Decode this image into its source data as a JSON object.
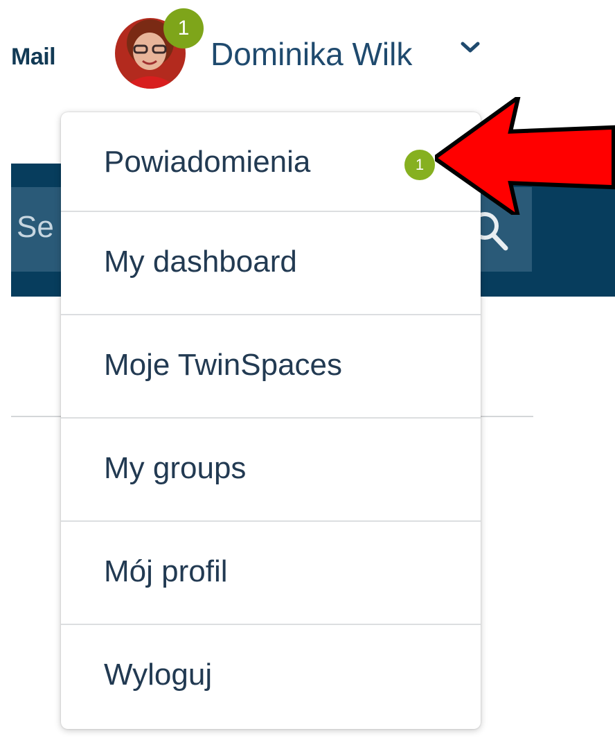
{
  "header": {
    "mail_label": "Mail",
    "user_name": "Dominika Wilk",
    "avatar_badge": "1",
    "search_placeholder": "Se"
  },
  "menu": {
    "items": [
      {
        "label": "Powiadomienia",
        "badge": "1"
      },
      {
        "label": "My dashboard"
      },
      {
        "label": "Moje TwinSpaces"
      },
      {
        "label": "My groups"
      },
      {
        "label": "Mój profil"
      },
      {
        "label": "Wyloguj"
      }
    ]
  },
  "icons": {
    "caret": "chevron-down-icon",
    "search": "search-icon",
    "annotation": "red-arrow-icon"
  },
  "colors": {
    "navy": "#073d5d",
    "badge_green": "#86b020",
    "arrow_red": "#ff0000"
  }
}
